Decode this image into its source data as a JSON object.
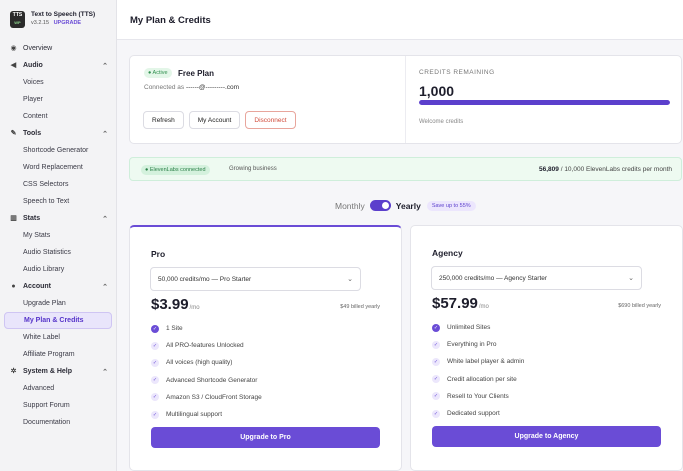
{
  "brand": {
    "logo_top": "TTS",
    "logo_bottom": "WP",
    "title": "Text to Speech (TTS)",
    "version": "v3.2.15",
    "upgrade": "UPGRADE"
  },
  "sidebar": {
    "overview": "Overview",
    "audio": {
      "label": "Audio",
      "items": [
        "Voices",
        "Player",
        "Content"
      ]
    },
    "tools": {
      "label": "Tools",
      "items": [
        "Shortcode Generator",
        "Word Replacement",
        "CSS Selectors",
        "Speech to Text"
      ]
    },
    "stats": {
      "label": "Stats",
      "items": [
        "My Stats",
        "Audio Statistics",
        "Audio Library"
      ]
    },
    "account": {
      "label": "Account",
      "items": [
        "Upgrade Plan",
        "My Plan & Credits",
        "White Label",
        "Affiliate Program"
      ]
    },
    "system": {
      "label": "System & Help",
      "items": [
        "Advanced",
        "Support Forum",
        "Documentation"
      ]
    }
  },
  "header": {
    "title": "My Plan & Credits"
  },
  "plan": {
    "status": "Active",
    "name": "Free Plan",
    "connected_prefix": "Connected as",
    "connected_email": "------@---------.com",
    "buttons": {
      "refresh": "Refresh",
      "account": "My Account",
      "disconnect": "Disconnect"
    },
    "credits_label": "CREDITS REMAINING",
    "credits_value": "1,000",
    "credits_fill_percent": 100,
    "credits_note": "Welcome credits"
  },
  "elevenlabs": {
    "badge": "ElevenLabs connected",
    "status": "Growing business",
    "used": "56,809",
    "total_text": "/ 10,000 ElevenLabs credits per month"
  },
  "billing": {
    "monthly": "Monthly",
    "yearly": "Yearly",
    "yearly_selected": true,
    "save": "Save up to 55%"
  },
  "pro": {
    "name": "Pro",
    "select": "50,000 credits/mo — Pro Starter",
    "price": "$3.99",
    "period": "/mo",
    "billed": "$49 billed yearly",
    "features": [
      "1 Site",
      "All PRO-features Unlocked",
      "All voices (high quality)",
      "Advanced Shortcode Generator",
      "Amazon S3 / CloudFront Storage",
      "Multilingual support"
    ],
    "cta": "Upgrade to Pro"
  },
  "agency": {
    "name": "Agency",
    "select": "250,000 credits/mo — Agency Starter",
    "price": "$57.99",
    "period": "/mo",
    "billed": "$690 billed yearly",
    "features": [
      "Unlimited Sites",
      "Everything in Pro",
      "White label player & admin",
      "Credit allocation per site",
      "Resell to Your Clients",
      "Dedicated support"
    ],
    "cta": "Upgrade to Agency"
  },
  "colors": {
    "accent": "#6a4cd6",
    "success": "#2f8f4e",
    "danger": "#d14b3b"
  }
}
